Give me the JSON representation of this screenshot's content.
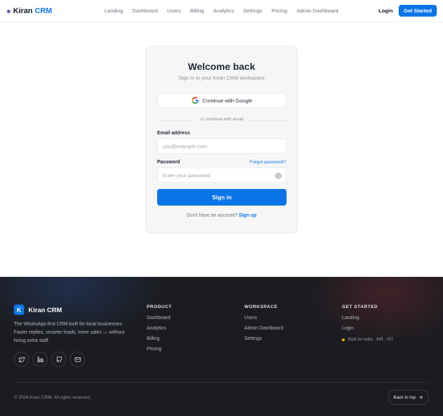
{
  "nav": {
    "brand_first": "Kiran",
    "brand_second": "CRM",
    "links": [
      "Landing",
      "Dashboard",
      "Users",
      "Billing",
      "Analytics",
      "Settings",
      "Pricing",
      "Admin Dashboard"
    ],
    "login_label": "Login",
    "cta_label": "Get Started"
  },
  "signin": {
    "title": "Welcome back",
    "subtitle": "Sign in to your Kiran CRM workspace",
    "google_label": "Continue with Google",
    "divider_text": "or continue with email",
    "email_label": "Email address",
    "email_placeholder": "you@example.com",
    "password_label": "Password",
    "forgot_label": "Forgot password?",
    "password_placeholder": "Enter your password",
    "submit_label": "Sign in",
    "no_account_text": "Don't have an account?",
    "signup_label": "Sign up"
  },
  "footer": {
    "logo_letter": "K",
    "brand": "Kiran CRM",
    "description": "The WhatsApp-first CRM built for local businesses. Faster replies, smarter leads, more sales — without hiring extra staff.",
    "social_icons": [
      "twitter-icon",
      "linkedin-icon",
      "github-icon",
      "mail-icon"
    ],
    "columns": [
      {
        "heading": "PRODUCT",
        "items": [
          "Dashboard",
          "Analytics",
          "Billing",
          "Pricing"
        ]
      },
      {
        "heading": "WORKSPACE",
        "items": [
          "Users",
          "Admin Dashboard",
          "Settings"
        ]
      },
      {
        "heading": "GET STARTED",
        "items": [
          "Landing",
          "Login"
        ]
      }
    ],
    "region_note": "Built for India · INR · IST",
    "copyright": "© 2026 Kiran CRM. All rights reserved.",
    "back_to_top": "Back to top"
  },
  "colors": {
    "accent": "#0b74e6",
    "footer_bg": "#1b1c20",
    "region_dot": "#f5b400"
  }
}
